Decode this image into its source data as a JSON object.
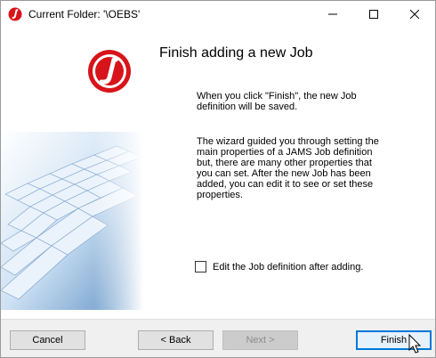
{
  "window": {
    "title": "Current Folder: '\\OEBS'",
    "app_icon": "jams-logo-icon",
    "controls": [
      "minimize-icon",
      "maximize-icon",
      "close-icon"
    ]
  },
  "wizard": {
    "heading": "Finish adding a new Job",
    "paragraph1": "When you click \"Finish\", the new Job\ndefinition will be saved.",
    "paragraph2": "The wizard guided you through setting the\nmain properties of a JAMS Job definition\nbut, there are many other properties that\nyou can set.  After the new Job has been\nadded, you can edit it to see or set these\nproperties.",
    "checkbox_label": "Edit the Job definition after adding.",
    "checkbox_checked": false
  },
  "buttons": {
    "cancel": "Cancel",
    "back": "< Back",
    "next": "Next >",
    "finish": "Finish",
    "next_enabled": false
  },
  "colors": {
    "logo_red": "#d7141a",
    "accent": "#0078d7"
  }
}
